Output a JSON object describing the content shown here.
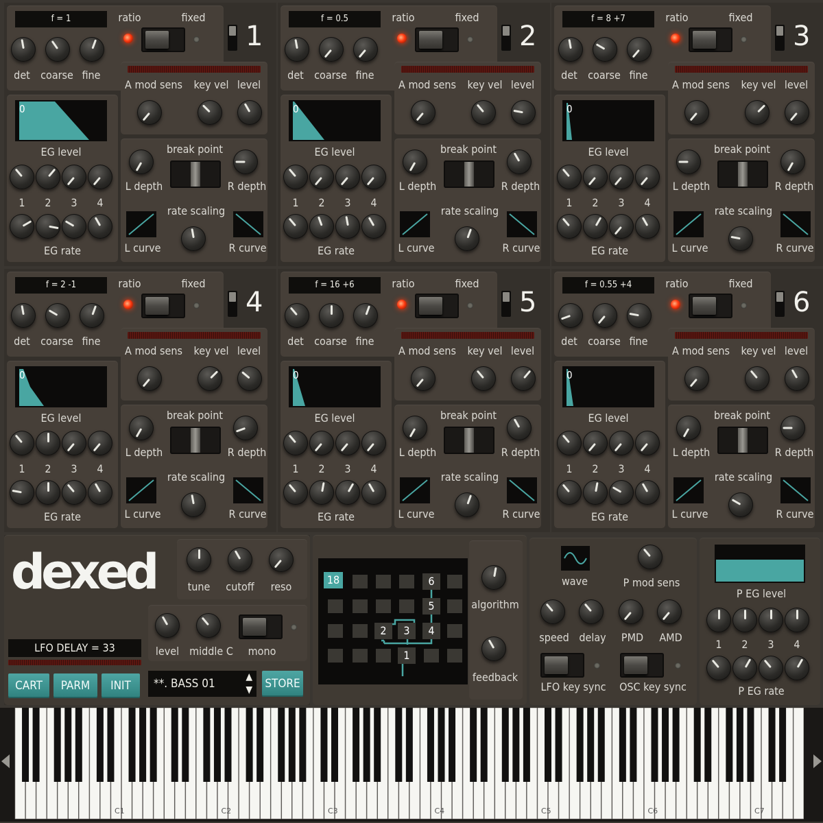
{
  "labels": {
    "ratio": "ratio",
    "fixed": "fixed",
    "det": "det",
    "coarse": "coarse",
    "fine": "fine",
    "a_mod_sens": "A mod sens",
    "key_vel": "key vel",
    "level": "level",
    "eg_level": "EG level",
    "break_point": "break point",
    "l_depth": "L depth",
    "r_depth": "R depth",
    "rate_scaling": "rate scaling",
    "l_curve": "L curve",
    "r_curve": "R curve",
    "eg_rate": "EG rate",
    "n1": "1",
    "n2": "2",
    "n3": "3",
    "n4": "4"
  },
  "operators": [
    {
      "number": "1",
      "freq": "f = 1",
      "eg_value": "0"
    },
    {
      "number": "2",
      "freq": "f = 0.5",
      "eg_value": "0"
    },
    {
      "number": "3",
      "freq": "f = 8 +7",
      "eg_value": "0"
    },
    {
      "number": "4",
      "freq": "f = 2 -1",
      "eg_value": "0"
    },
    {
      "number": "5",
      "freq": "f = 16 +6",
      "eg_value": "0"
    },
    {
      "number": "6",
      "freq": "f = 0.55 +4",
      "eg_value": "0"
    }
  ],
  "global": {
    "logo": "dexed",
    "tune": "tune",
    "cutoff": "cutoff",
    "reso": "reso",
    "level": "level",
    "middle_c": "middle C",
    "mono": "mono",
    "lcd": "LFO DELAY = 33",
    "cart": "CART",
    "parm": "PARM",
    "init": "INIT",
    "program": "**. BASS 01",
    "store": "STORE"
  },
  "algorithm": {
    "number": "18",
    "label_algorithm": "algorithm",
    "label_feedback": "feedback",
    "ops": [
      "6",
      "5",
      "2",
      "3",
      "4",
      "1"
    ]
  },
  "lfo": {
    "wave": "wave",
    "p_mod_sens": "P mod sens",
    "speed": "speed",
    "delay": "delay",
    "pmd": "PMD",
    "amd": "AMD",
    "lfo_key_sync": "LFO key sync",
    "osc_key_sync": "OSC key sync"
  },
  "pitch_eg": {
    "p_eg_level": "P EG level",
    "p_eg_rate": "P EG rate",
    "n1": "1",
    "n2": "2",
    "n3": "3",
    "n4": "4"
  },
  "keyboard": {
    "octave_labels": [
      "C1",
      "C2",
      "C3",
      "C4",
      "C5",
      "C6",
      "C7"
    ]
  },
  "colors": {
    "accent": "#49a6a2",
    "led": "#ff3a10",
    "panel": "#463f38",
    "background": "#34302b"
  }
}
